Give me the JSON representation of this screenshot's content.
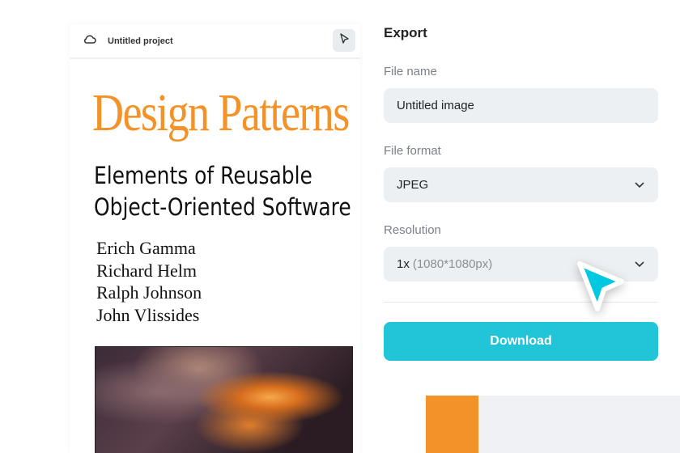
{
  "project": {
    "name": "Untitled project"
  },
  "cover": {
    "title": "Design Patterns",
    "subtitle_lines": [
      "Elements of Reusable",
      "Object-Oriented Software"
    ],
    "authors": [
      "Erich Gamma",
      "Richard Helm",
      "Ralph Johnson",
      "John Vlissides"
    ]
  },
  "export": {
    "heading": "Export",
    "file_name_label": "File name",
    "file_name_value": "Untitled image",
    "file_format_label": "File format",
    "file_format_value": "JPEG",
    "resolution_label": "Resolution",
    "resolution_scale": "1x",
    "resolution_detail": "(1080*1080px)",
    "download_label": "Download"
  },
  "colors": {
    "accent": "#22c4d8",
    "brand_orange": "#f39229"
  }
}
